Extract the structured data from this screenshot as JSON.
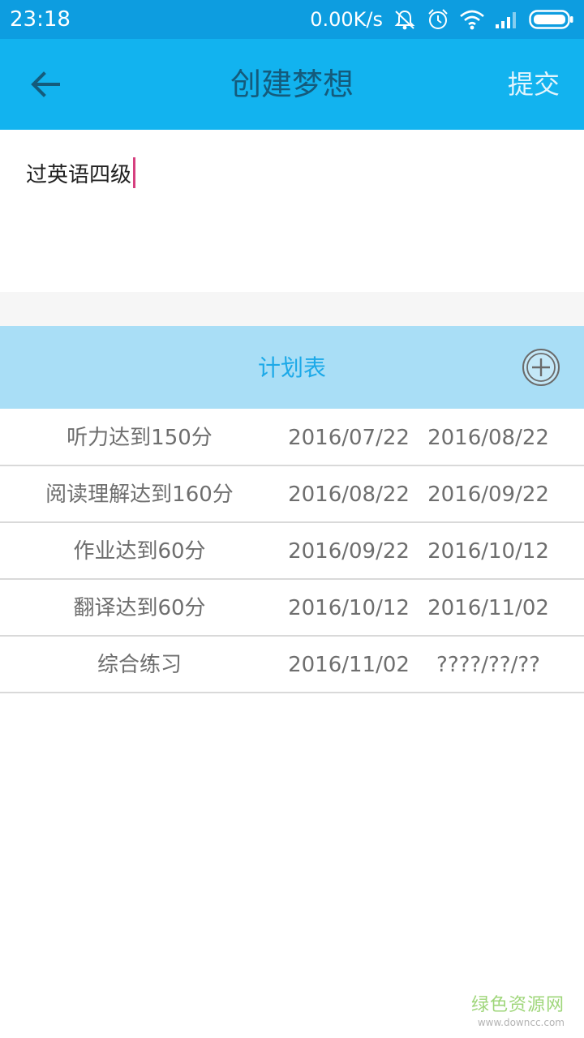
{
  "status_bar": {
    "time": "23:18",
    "speed": "0.00K/s",
    "icons": [
      "mute-icon",
      "alarm-icon",
      "wifi-icon",
      "signal-icon",
      "battery-icon"
    ]
  },
  "app_bar": {
    "back_icon": "arrow-left-icon",
    "title": "创建梦想",
    "submit_label": "提交"
  },
  "dream": {
    "value": "过英语四级"
  },
  "plan": {
    "title": "计划表",
    "add_icon": "plus-circle-icon",
    "rows": [
      {
        "task": "听力达到150分",
        "start": "2016/07/22",
        "end": "2016/08/22"
      },
      {
        "task": "阅读理解达到160分",
        "start": "2016/08/22",
        "end": "2016/09/22"
      },
      {
        "task": "作业达到60分",
        "start": "2016/09/22",
        "end": "2016/10/12"
      },
      {
        "task": "翻译达到60分",
        "start": "2016/10/12",
        "end": "2016/11/02"
      },
      {
        "task": "综合练习",
        "start": "2016/11/02",
        "end": "????/??/??"
      }
    ]
  },
  "watermark": {
    "main": "绿色资源网",
    "sub": "www.downcc.com"
  },
  "colors": {
    "status_bar": "#0d9de0",
    "app_bar": "#12b3ef",
    "title_text": "#145b7c",
    "plan_header": "#a9def6",
    "plan_title": "#1ca9e8",
    "caret": "#d6407f"
  }
}
